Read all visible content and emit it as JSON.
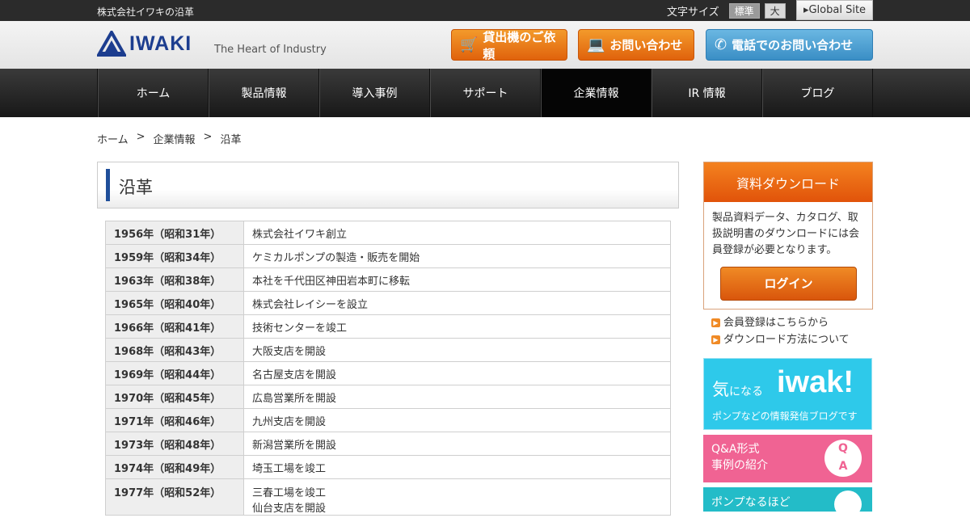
{
  "topbar": {
    "site_title": "株式会社イワキの沿革",
    "font_size_label": "文字サイズ",
    "font_size_standard": "標準",
    "font_size_large": "大",
    "global_site": "▸Global Site"
  },
  "header": {
    "logo_text": "IWAKI",
    "tagline": "The Heart of Industry",
    "rental_button": "貸出機のご依頼",
    "contact_button": "お問い合わせ",
    "phone_button": "電話でのお問い合わせ",
    "colors": {
      "orange": "#e8741a",
      "blue": "#4a9fd3",
      "logo_blue": "#1c3d8f"
    }
  },
  "nav": {
    "items": [
      {
        "label": "ホーム"
      },
      {
        "label": "製品情報"
      },
      {
        "label": "導入事例"
      },
      {
        "label": "サポート"
      },
      {
        "label": "企業情報"
      },
      {
        "label": "IR 情報"
      },
      {
        "label": "ブログ"
      }
    ],
    "active_index": 4
  },
  "breadcrumb": {
    "items": [
      "ホーム",
      "企業情報",
      "沿革"
    ],
    "separator": ">"
  },
  "main": {
    "title": "沿革",
    "history": [
      {
        "year": "1956年（昭和31年）",
        "event": "株式会社イワキ創立"
      },
      {
        "year": "1959年（昭和34年）",
        "event": "ケミカルポンプの製造・販売を開始"
      },
      {
        "year": "1963年（昭和38年）",
        "event": "本社を千代田区神田岩本町に移転"
      },
      {
        "year": "1965年（昭和40年）",
        "event": "株式会社レイシーを設立"
      },
      {
        "year": "1966年（昭和41年）",
        "event": "技術センターを竣工"
      },
      {
        "year": "1968年（昭和43年）",
        "event": "大阪支店を開設"
      },
      {
        "year": "1969年（昭和44年）",
        "event": "名古屋支店を開設"
      },
      {
        "year": "1970年（昭和45年）",
        "event": "広島営業所を開設"
      },
      {
        "year": "1971年（昭和46年）",
        "event": "九州支店を開設"
      },
      {
        "year": "1973年（昭和48年）",
        "event": "新潟営業所を開設"
      },
      {
        "year": "1974年（昭和49年）",
        "event": "埼玉工場を竣工"
      },
      {
        "year": "1977年（昭和52年）",
        "event": "三春工場を竣工",
        "event2": "仙台支店を開設"
      }
    ]
  },
  "sidebar": {
    "download_title": "資料ダウンロード",
    "download_text": "製品資料データ、カタログ、取扱説明書のダウンロードには会員登録が必要となります。",
    "login_button": "ログイン",
    "links": [
      "会員登録はこちらから",
      "ダウンロード方法について"
    ],
    "banner_iwaki_ki": "気",
    "banner_iwaki_ninaru": "になる",
    "banner_iwaki_word": "iwak!",
    "banner_iwaki_sub": "ポンプなどの情報発信ブログです",
    "banner_qa_line1": "Q&A形式",
    "banner_qa_line2": "事例の紹介",
    "banner_qa_q": "Q",
    "banner_qa_a": "A",
    "banner_pump": "ポンプなるほど"
  }
}
